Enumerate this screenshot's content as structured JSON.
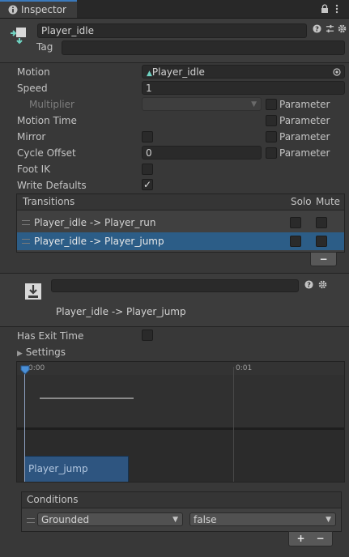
{
  "window": {
    "tab_title": "Inspector",
    "tab_icon": "info-icon",
    "toolbar_icons": [
      "lock-icon",
      "kebab-menu-icon"
    ]
  },
  "header": {
    "icon": "animator-state-icon",
    "name_value": "Player_idle",
    "tag_label": "Tag",
    "tag_value": "",
    "icons": [
      "help-icon",
      "preset-sliders-icon",
      "gear-icon"
    ]
  },
  "state": {
    "motion_label": "Motion",
    "motion_value": "Player_idle",
    "motion_icon": "animation-clip-icon",
    "speed_label": "Speed",
    "speed_value": "1",
    "multiplier_label": "Multiplier",
    "multiplier_value": "",
    "parameter_label": "Parameter",
    "motion_time_label": "Motion Time",
    "mirror_label": "Mirror",
    "cycle_offset_label": "Cycle Offset",
    "cycle_offset_value": "0",
    "foot_ik_label": "Foot IK",
    "write_defaults_label": "Write Defaults",
    "write_defaults_checked": true
  },
  "transitions": {
    "header_label": "Transitions",
    "solo_label": "Solo",
    "mute_label": "Mute",
    "rows": [
      {
        "label": "Player_idle -> Player_run",
        "selected": false
      },
      {
        "label": "Player_idle -> Player_jump",
        "selected": true
      }
    ],
    "remove_label": "−"
  },
  "transition_detail": {
    "name_value": "",
    "title": "Player_idle -> Player_jump",
    "icons": [
      "transition-icon",
      "help-icon",
      "gear-icon"
    ],
    "has_exit_time_label": "Has Exit Time",
    "settings_label": "Settings",
    "timeline": {
      "tick_start": "0:00",
      "tick_end": "0:01",
      "clip_label": "Player_jump"
    }
  },
  "conditions": {
    "header_label": "Conditions",
    "parameter_value": "Grounded",
    "value": "false",
    "add_label": "+",
    "remove_label": "−"
  }
}
